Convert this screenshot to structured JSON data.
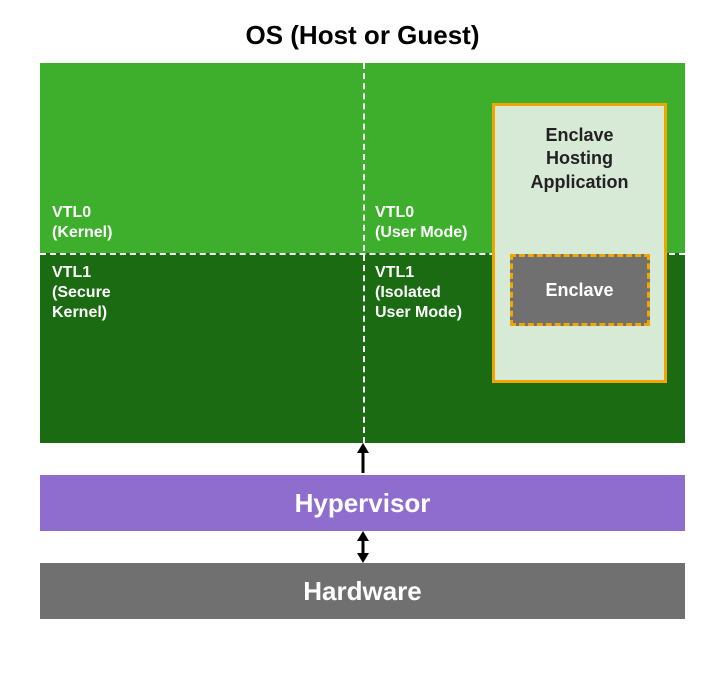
{
  "title": "OS (Host or Guest)",
  "quadrants": {
    "vtl0_kernel": "VTL0\n(Kernel)",
    "vtl0_user": "VTL0\n(User Mode)",
    "vtl1_secure_kernel": "VTL1\n(Secure\nKernel)",
    "vtl1_isolated_user": "VTL1\n(Isolated\nUser Mode)"
  },
  "enclave_app_label": "Enclave\nHosting\nApplication",
  "enclave_label": "Enclave",
  "hypervisor": "Hypervisor",
  "hardware": "Hardware",
  "colors": {
    "os_top": "#3daf2c",
    "os_bottom": "#1a6b12",
    "enclave_app_bg": "#d6ead6",
    "enclave_border": "#f0a500",
    "enclave_bg": "#707070",
    "hypervisor": "#8e6dcf",
    "hardware": "#707070"
  }
}
